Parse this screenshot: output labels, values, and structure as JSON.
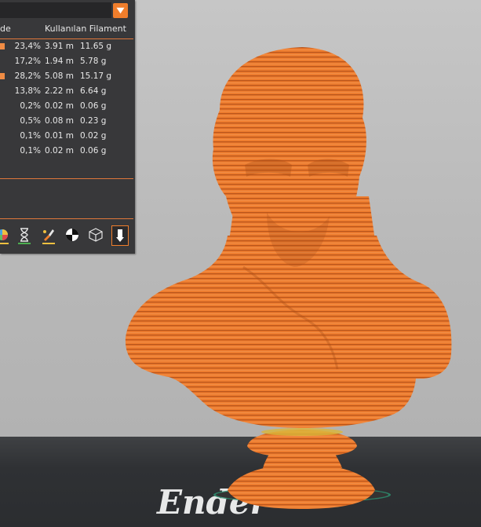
{
  "panel": {
    "header_left": "de",
    "header_right": "Kullanılan Filament",
    "rows": [
      {
        "swatch": true,
        "percent": "23,4%",
        "length": "3.91 m",
        "weight": "11.65 g"
      },
      {
        "swatch": false,
        "percent": "17,2%",
        "length": "1.94 m",
        "weight": "5.78 g"
      },
      {
        "swatch": true,
        "percent": "28,2%",
        "length": "5.08 m",
        "weight": "15.17 g"
      },
      {
        "swatch": false,
        "percent": "13,8%",
        "length": "2.22 m",
        "weight": "6.64 g"
      },
      {
        "swatch": false,
        "percent": "0,2%",
        "length": "0.02 m",
        "weight": "0.06 g"
      },
      {
        "swatch": false,
        "percent": "0,5%",
        "length": "0.08 m",
        "weight": "0.23 g"
      },
      {
        "swatch": false,
        "percent": "0,1%",
        "length": "0.01 m",
        "weight": "0.02 g"
      },
      {
        "swatch": false,
        "percent": "0,1%",
        "length": "0.02 m",
        "weight": "0.06 g"
      }
    ],
    "toolbar_icons": [
      "color-wheel-icon",
      "hourglass-icon",
      "paint-brush-icon",
      "checker-circle-icon",
      "cube-icon",
      "export-icon"
    ]
  },
  "scene": {
    "model_color": "#ee7d2f",
    "bed_label": "Ender"
  }
}
